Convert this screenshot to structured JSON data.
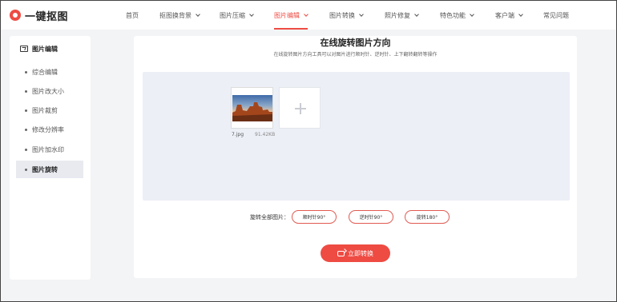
{
  "app": {
    "logo_text": "一键抠图",
    "brand_color": "#ee4b43"
  },
  "nav": {
    "items": [
      {
        "label": "首页",
        "has_dropdown": false,
        "active": false
      },
      {
        "label": "抠图换背景",
        "has_dropdown": true,
        "active": false
      },
      {
        "label": "图片压缩",
        "has_dropdown": true,
        "active": false
      },
      {
        "label": "图片编辑",
        "has_dropdown": true,
        "active": true
      },
      {
        "label": "图片转换",
        "has_dropdown": true,
        "active": false
      },
      {
        "label": "照片修复",
        "has_dropdown": true,
        "active": false
      },
      {
        "label": "特色功能",
        "has_dropdown": true,
        "active": false
      },
      {
        "label": "客户端",
        "has_dropdown": true,
        "active": false
      },
      {
        "label": "常见问题",
        "has_dropdown": false,
        "active": false
      }
    ]
  },
  "sidebar": {
    "header": "图片编辑",
    "header_icon": "image-icon",
    "items": [
      {
        "label": "综合编辑",
        "active": false
      },
      {
        "label": "图片改大小",
        "active": false
      },
      {
        "label": "图片裁剪",
        "active": false
      },
      {
        "label": "修改分辨率",
        "active": false
      },
      {
        "label": "图片加水印",
        "active": false
      },
      {
        "label": "图片旋转",
        "active": true
      }
    ]
  },
  "main": {
    "title": "在线旋转图片方向",
    "subtitle": "在线旋转图片方向工具可以对图片进行顺时针、逆时针、上下翻转翻转等操作",
    "file": {
      "name": "7.jpg",
      "size": "91.42KB"
    },
    "add_icon": "plus-icon",
    "rotate_label": "旋转全部图片：",
    "rotate_buttons": [
      {
        "label": "顺时针90°"
      },
      {
        "label": "逆时针90°"
      },
      {
        "label": "旋转180°"
      }
    ],
    "convert_label": "立即转换",
    "convert_icon": "convert-icon"
  }
}
